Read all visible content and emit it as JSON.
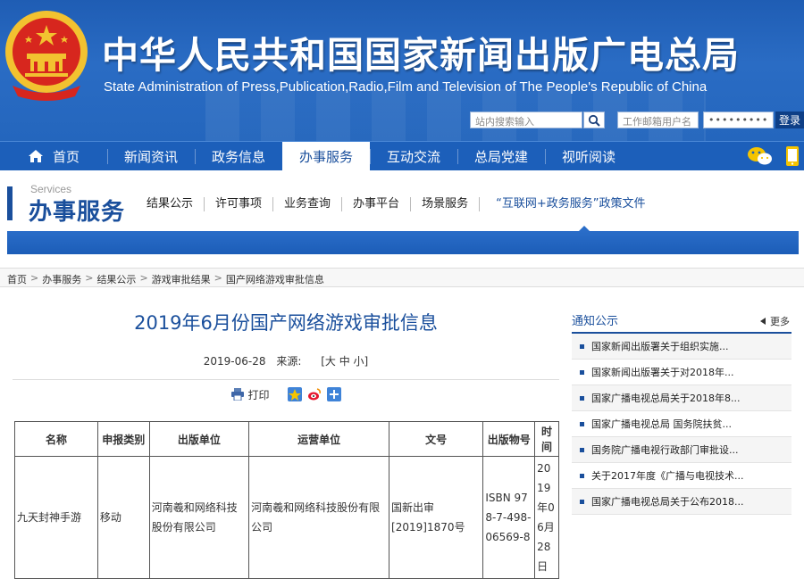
{
  "header": {
    "title": "中华人民共和国国家新闻出版广电总局",
    "subtitle": "State Administration of Press,Publication,Radio,Film and Television of The People's Republic of China",
    "search_placeholder": "站内搜索输入",
    "mail_user_placeholder": "工作邮箱用户名",
    "mail_password_value": "•••••••••",
    "login_label": "登录"
  },
  "nav": {
    "items": [
      {
        "label": "首页"
      },
      {
        "label": "新闻资讯"
      },
      {
        "label": "政务信息"
      },
      {
        "label": "办事服务"
      },
      {
        "label": "互动交流"
      },
      {
        "label": "总局党建"
      },
      {
        "label": "视听阅读"
      }
    ],
    "active_index": 3
  },
  "section": {
    "en": "Services",
    "zh": "办事服务",
    "links": [
      {
        "label": "结果公示"
      },
      {
        "label": "许可事项"
      },
      {
        "label": "业务查询"
      },
      {
        "label": "办事平台"
      },
      {
        "label": "场景服务"
      },
      {
        "label": "“互联网+政务服务”政策文件"
      }
    ]
  },
  "breadcrumb": [
    "首页",
    "办事服务",
    "结果公示",
    "游戏审批结果",
    "国产网络游戏审批信息"
  ],
  "article": {
    "title": "2019年6月份国产网络游戏审批信息",
    "date": "2019-06-28",
    "source_label": "来源:",
    "font_size_control": "[大 中 小]",
    "print_label": "打印"
  },
  "table": {
    "headers": [
      "名称",
      "申报类别",
      "出版单位",
      "运营单位",
      "文号",
      "出版物号",
      "时间"
    ],
    "rows": [
      {
        "name": "九天封神手游",
        "category": "移动",
        "publisher": "河南羲和网络科技股份有限公司",
        "operator": "河南羲和网络科技股份有限公司",
        "doc_no": "国新出审[2019]1870号",
        "isbn": "ISBN 978-7-498-06569-8",
        "time": "2019年06月28日"
      }
    ]
  },
  "sidebar": {
    "title": "通知公示",
    "more_label": "更多",
    "items": [
      {
        "label": "国家新闻出版署关于组织实施..."
      },
      {
        "label": "国家新闻出版署关于对2018年..."
      },
      {
        "label": "国家广播电视总局关于2018年8..."
      },
      {
        "label": "国家广播电视总局 国务院扶贫..."
      },
      {
        "label": "国务院广播电视行政部门审批设..."
      },
      {
        "label": "关于2017年度《广播与电视技术..."
      },
      {
        "label": "国家广播电视总局关于公布2018..."
      }
    ]
  },
  "colors": {
    "brand_blue": "#1c5fba",
    "title_blue": "#1a4f9c",
    "emblem_red": "#d7261e",
    "emblem_gold": "#f2c230"
  }
}
